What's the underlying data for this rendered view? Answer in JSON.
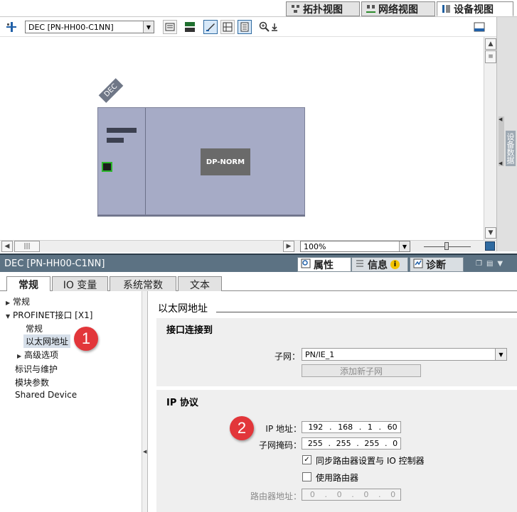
{
  "view_tabs": [
    {
      "label": "拓扑视图",
      "active": false
    },
    {
      "label": "网络视图",
      "active": false
    },
    {
      "label": "设备视图",
      "active": true
    }
  ],
  "toolbar": {
    "device_select": "DEC [PN-HH00-C1NN]"
  },
  "side_strip": {
    "label": "设备数据"
  },
  "canvas": {
    "device_tag": "DEC",
    "module_label": "DP-NORM",
    "zoom": "100%"
  },
  "inspector": {
    "title": "DEC [PN-HH00-C1NN]",
    "tabs": [
      {
        "label": "属性",
        "active": true
      },
      {
        "label": "信息",
        "active": false
      },
      {
        "label": "诊断",
        "active": false
      }
    ],
    "subtabs": [
      {
        "label": "常规",
        "active": true
      },
      {
        "label": "IO 变量",
        "active": false
      },
      {
        "label": "系统常数",
        "active": false
      },
      {
        "label": "文本",
        "active": false
      }
    ],
    "tree": [
      {
        "label": "常规"
      },
      {
        "label": "PROFINET接口 [X1]"
      },
      {
        "label": "常规"
      },
      {
        "label": "以太网地址"
      },
      {
        "label": "高级选项"
      },
      {
        "label": "标识与维护"
      },
      {
        "label": "模块参数"
      },
      {
        "label": "Shared Device"
      }
    ],
    "content": {
      "section_title": "以太网地址",
      "interface_heading": "接口连接到",
      "subnet_label": "子网：",
      "subnet_value": "PN/IE_1",
      "add_subnet_button": "添加新子网",
      "ip_heading": "IP 协议",
      "ip_label": "IP 地址：",
      "ip_value": [
        "192",
        "168",
        "1",
        "60"
      ],
      "mask_label": "子网掩码：",
      "mask_value": [
        "255",
        "255",
        "255",
        "0"
      ],
      "sync_router_label": "同步路由器设置与 IO 控制器",
      "sync_router_checked": true,
      "use_router_label": "使用路由器",
      "use_router_checked": false,
      "router_label": "路由器地址：",
      "router_value": [
        "0",
        "0",
        "0",
        "0"
      ]
    }
  },
  "annotations": [
    "1",
    "2"
  ],
  "colors": {
    "badge": "#e2363a",
    "inspector_title": "#5c7283",
    "device_body": "#a6abc6"
  }
}
